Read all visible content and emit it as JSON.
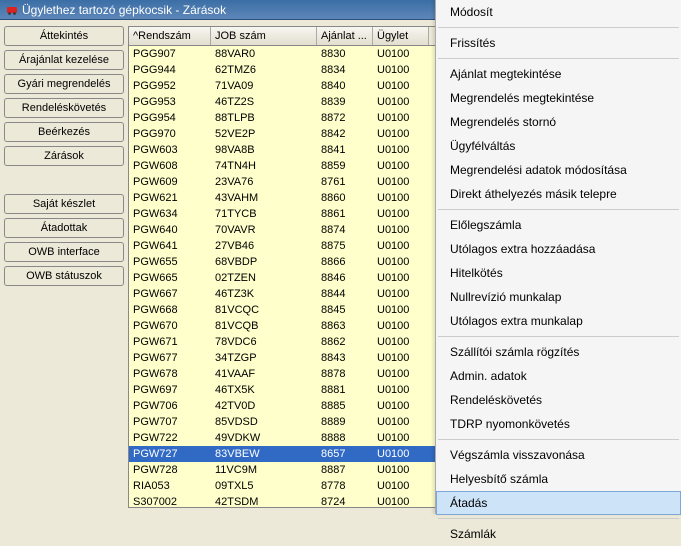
{
  "window": {
    "title": "Ügylethez tartozó gépkocsik - Zárások"
  },
  "sidebar": {
    "buttons_top": [
      {
        "id": "overview",
        "label": "Áttekintés"
      },
      {
        "id": "offer",
        "label": "Árajánlat kezelése"
      },
      {
        "id": "factory",
        "label": "Gyári megrendelés"
      },
      {
        "id": "ordertrack",
        "label": "Rendeléskövetés"
      },
      {
        "id": "receipt",
        "label": "Beérkezés"
      },
      {
        "id": "closing",
        "label": "Zárások"
      }
    ],
    "buttons_bottom": [
      {
        "id": "stock",
        "label": "Saját készlet"
      },
      {
        "id": "handed",
        "label": "Átadottak"
      },
      {
        "id": "owbif",
        "label": "OWB interface"
      },
      {
        "id": "owbst",
        "label": "OWB státuszok"
      }
    ]
  },
  "table": {
    "headers": [
      "^Rendszám",
      "JOB szám",
      "Ajánlat ...",
      "Ügylet"
    ],
    "selectedIndex": 23,
    "rows": [
      [
        "PGG907",
        "88VAR0",
        "8830",
        "U0100"
      ],
      [
        "PGG944",
        "62TMZ6",
        "8834",
        "U0100"
      ],
      [
        "PGG952",
        "71VA09",
        "8840",
        "U0100"
      ],
      [
        "PGG953",
        "46TZ2S",
        "8839",
        "U0100"
      ],
      [
        "PGG954",
        "88TLPB",
        "8872",
        "U0100"
      ],
      [
        "PGG970",
        "52VE2P",
        "8842",
        "U0100"
      ],
      [
        "PGW603",
        "98VA8B",
        "8841",
        "U0100"
      ],
      [
        "PGW608",
        "74TN4H",
        "8859",
        "U0100"
      ],
      [
        "PGW609",
        "23VA76",
        "8761",
        "U0100"
      ],
      [
        "PGW621",
        "43VAHM",
        "8860",
        "U0100"
      ],
      [
        "PGW634",
        "71TYCB",
        "8861",
        "U0100"
      ],
      [
        "PGW640",
        "70VAVR",
        "8874",
        "U0100"
      ],
      [
        "PGW641",
        "27VB46",
        "8875",
        "U0100"
      ],
      [
        "PGW655",
        "68VBDP",
        "8866",
        "U0100"
      ],
      [
        "PGW665",
        "02TZEN",
        "8846",
        "U0100"
      ],
      [
        "PGW667",
        "46TZ3K",
        "8844",
        "U0100"
      ],
      [
        "PGW668",
        "81VCQC",
        "8845",
        "U0100"
      ],
      [
        "PGW670",
        "81VCQB",
        "8863",
        "U0100"
      ],
      [
        "PGW671",
        "78VDC6",
        "8862",
        "U0100"
      ],
      [
        "PGW677",
        "34TZGP",
        "8843",
        "U0100"
      ],
      [
        "PGW678",
        "41VAAF",
        "8878",
        "U0100"
      ],
      [
        "PGW697",
        "46TX5K",
        "8881",
        "U0100"
      ],
      [
        "PGW706",
        "42TV0D",
        "8885",
        "U0100"
      ],
      [
        "PGW707",
        "85VDSD",
        "8889",
        "U0100"
      ],
      [
        "PGW722",
        "49VDKW",
        "8888",
        "U0100"
      ],
      [
        "PGW727",
        "83VBEW",
        "8657",
        "U0100"
      ],
      [
        "PGW728",
        "11VC9M",
        "8887",
        "U0100"
      ],
      [
        "RIA053",
        "09TXL5",
        "8778",
        "U0100"
      ],
      [
        "S307002",
        "42TSDM",
        "8724",
        "U0100"
      ]
    ]
  },
  "contextMenu": {
    "highlight": "atadas",
    "groups": [
      [
        "Módosít"
      ],
      [
        "Frissítés"
      ],
      [
        "Ajánlat megtekintése",
        "Megrendelés megtekintése",
        "Megrendelés stornó",
        "Ügyfélváltás",
        "Megrendelési adatok módosítása",
        "Direkt áthelyezés másik telepre"
      ],
      [
        "Előlegszámla",
        "Utólagos extra hozzáadása",
        "Hitelkötés",
        "Nullrevízió munkalap",
        "Utólagos extra munkalap"
      ],
      [
        "Szállítói számla rögzítés",
        "Admin. adatok",
        "Rendeléskövetés",
        "TDRP nyomonkövetés"
      ],
      [
        "Végszámla visszavonása",
        "Helyesbítő számla",
        "Átadás"
      ],
      [
        "Számlák"
      ]
    ]
  }
}
